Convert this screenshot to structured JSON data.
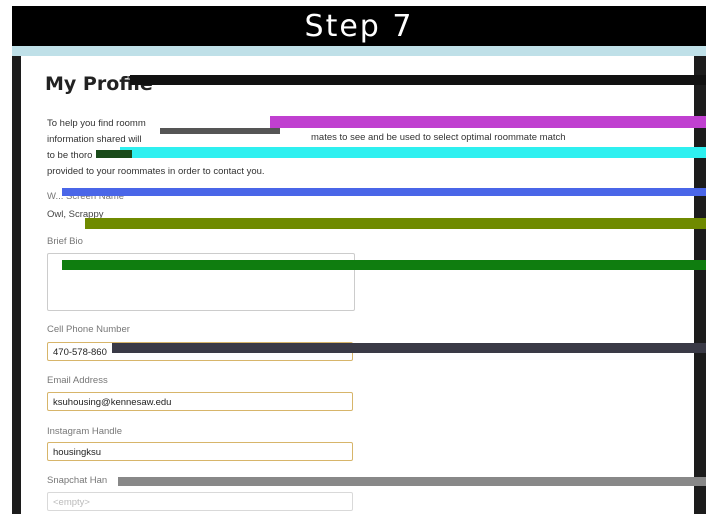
{
  "banner": {
    "title": "Step 7"
  },
  "profile": {
    "title": "My Profile",
    "intro_lines": [
      "To help you find roomm",
      "information shared will",
      "to be thoro",
      "provided to your roommates in order to contact you."
    ],
    "intro_fragment": "mates to see and       be used to select optimal roommate match",
    "screen_name_label": "W... Screen Name",
    "screen_name_value": "Owl, Scrappy",
    "bio_label": "Brief Bio",
    "bio_value": "",
    "phone_label": "Cell Phone Number",
    "phone_value": "470-578-860",
    "email_label": "Email Address",
    "email_value": "ksuhousing@kennesaw.edu",
    "instagram_label": "Instagram Handle",
    "instagram_value": "housingksu",
    "snapchat_label": "Snapchat Han",
    "snapchat_placeholder": "<empty>"
  },
  "colors": {
    "accent_border": "#d7b56a",
    "banner": "#000000",
    "band": "#bfe0e8"
  }
}
